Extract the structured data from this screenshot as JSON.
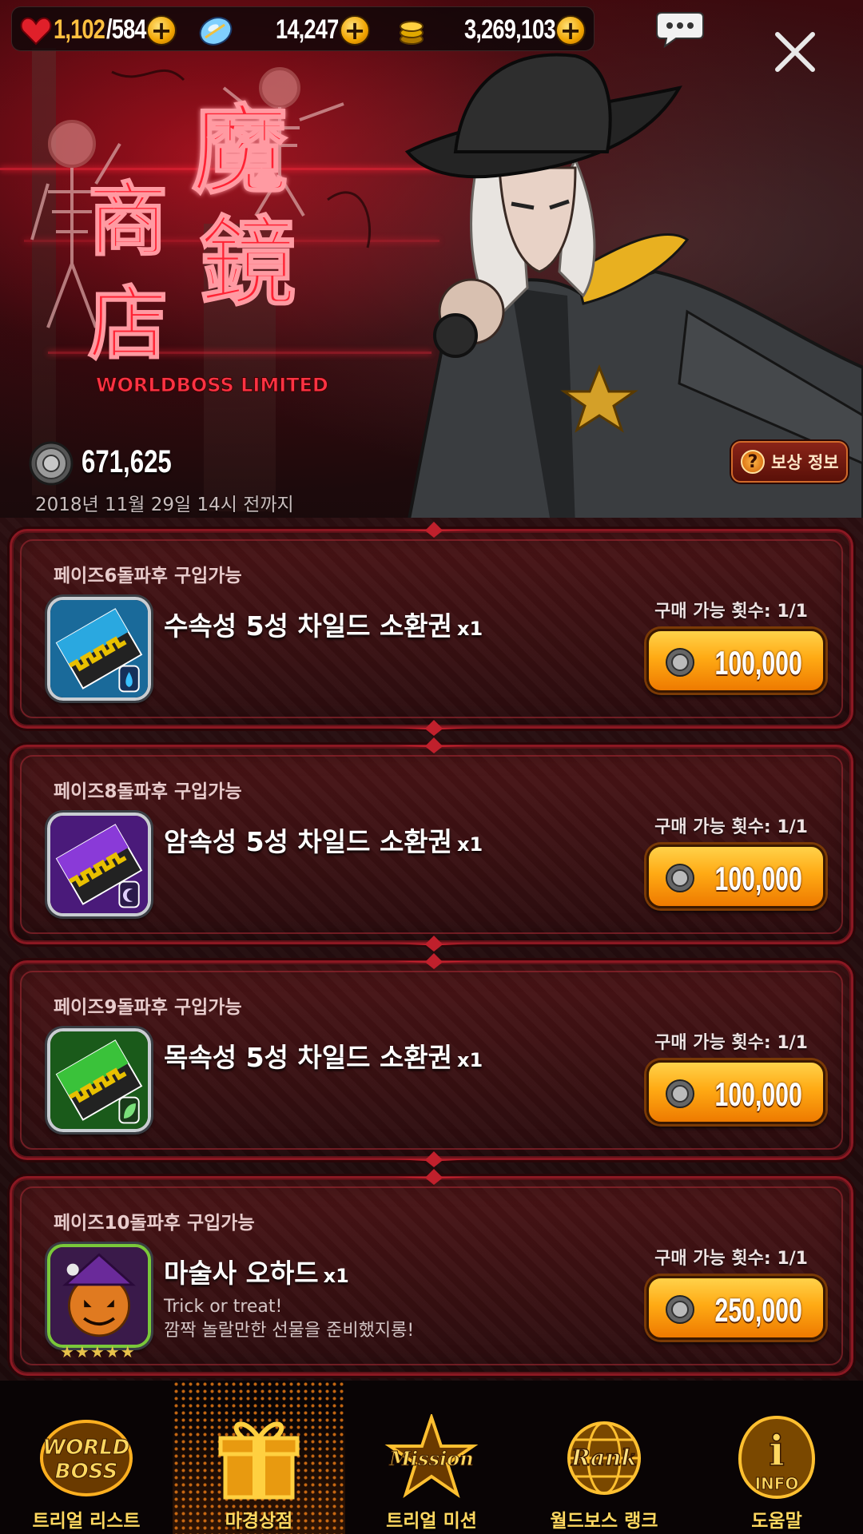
{
  "currency": {
    "stamina_current": "1,102",
    "stamina_max": "/584",
    "gems": "14,247",
    "gold": "3,269,103",
    "plus_symbol": "+"
  },
  "shop": {
    "logo_text_1": "魔",
    "logo_text_2": "鏡",
    "logo_text_3": "商",
    "logo_text_4": "店",
    "logo_subtitle": "WORLDBOSS LIMITED",
    "balance": "671,625",
    "deadline": "2018년 11월 29일 14시 전까지",
    "reward_info_label": "보상 정보",
    "reward_info_symbol": "?"
  },
  "items": [
    {
      "condition": "페이즈6돌파후 구입가능",
      "name": "수속성 5성 차일드 소환권",
      "qty": "x1",
      "desc_1": "",
      "desc_2": "",
      "limit": "구매 가능 횟수: 1/1",
      "price": "100,000",
      "color": "#2aa8e0"
    },
    {
      "condition": "페이즈8돌파후 구입가능",
      "name": "암속성 5성 차일드 소환권",
      "qty": "x1",
      "desc_1": "",
      "desc_2": "",
      "limit": "구매 가능 횟수: 1/1",
      "price": "100,000",
      "color": "#8a3ad8"
    },
    {
      "condition": "페이즈9돌파후 구입가능",
      "name": "목속성 5성 차일드 소환권",
      "qty": "x1",
      "desc_1": "",
      "desc_2": "",
      "limit": "구매 가능 횟수: 1/1",
      "price": "100,000",
      "color": "#3ac23a"
    },
    {
      "condition": "페이즈10돌파후 구입가능",
      "name": "마술사 오하드",
      "qty": "x1",
      "desc_1": "Trick or treat!",
      "desc_2": "깜짝 놀랄만한 선물을 준비했지롱!",
      "limit": "구매 가능 횟수: 1/1",
      "price": "250,000",
      "stars": "★★★★★",
      "color": "#7a3ab8"
    }
  ],
  "nav": [
    {
      "label": "트리얼 리스트",
      "icon": "world-boss-icon",
      "icon_text_1": "WORLD",
      "icon_text_2": "BOSS"
    },
    {
      "label": "마경상점",
      "icon": "gift-icon",
      "active": true
    },
    {
      "label": "트리얼 미션",
      "icon": "mission-icon",
      "icon_text_1": "Mission"
    },
    {
      "label": "월드보스 랭크",
      "icon": "rank-icon",
      "icon_text_1": "Rank"
    },
    {
      "label": "도움말",
      "icon": "info-icon",
      "icon_text_1": "i",
      "icon_text_2": "INFO"
    }
  ],
  "colors": {
    "accent_gold": "#ffb020",
    "frame_red": "#8a1822",
    "nav_label": "#ffd860"
  }
}
